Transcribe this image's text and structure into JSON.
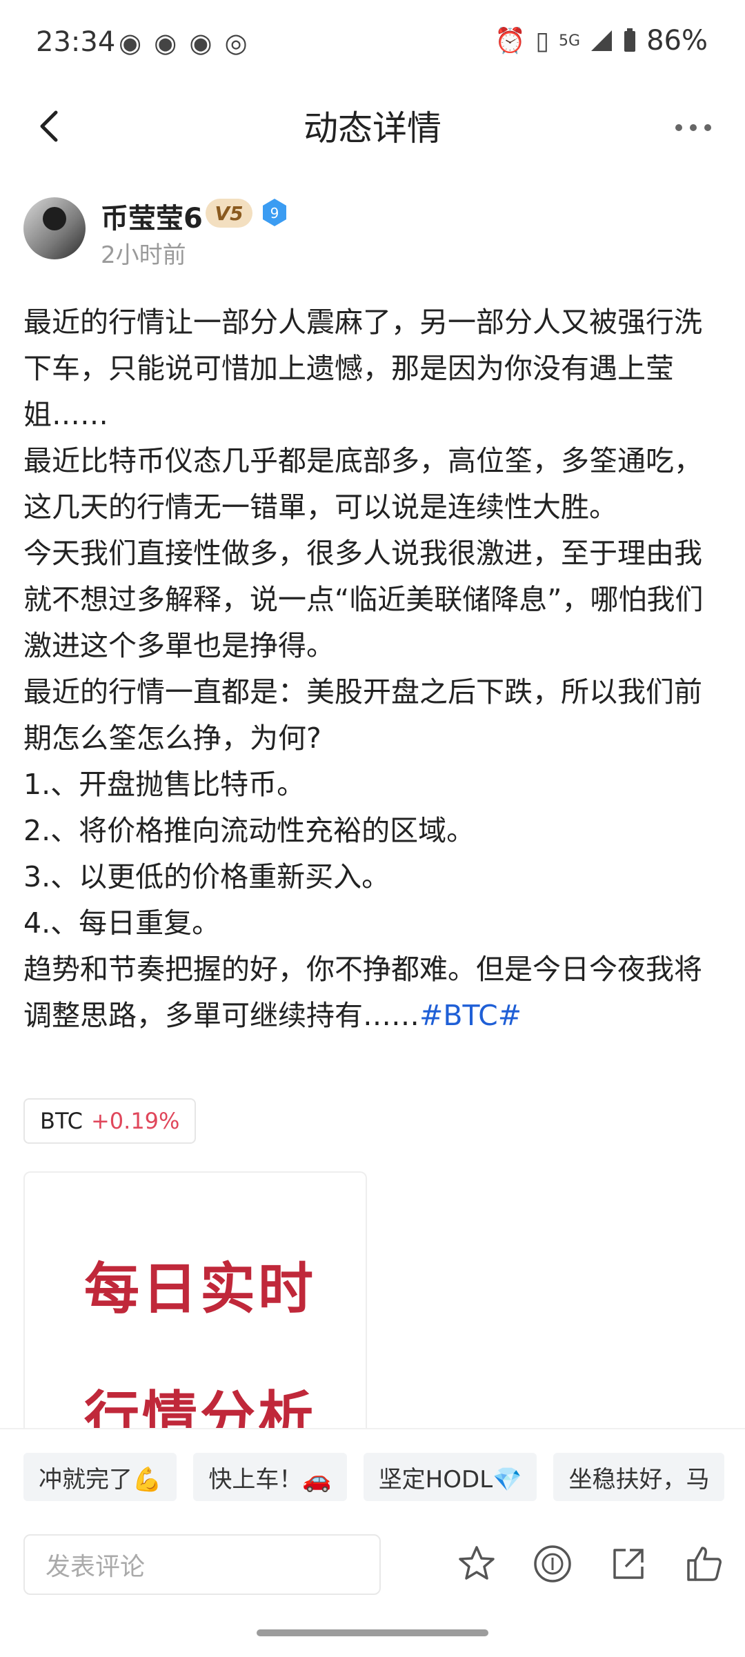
{
  "status_bar": {
    "time": "23:34",
    "app_icons": [
      "weibo-icon",
      "weibo-icon",
      "weibo-icon",
      "camera-icon"
    ],
    "right_icons": [
      "alarm-icon",
      "vibrate-icon",
      "5g-icon",
      "signal-icon",
      "battery-icon"
    ],
    "network": "5G",
    "battery": "86%"
  },
  "header": {
    "title": "动态详情"
  },
  "author": {
    "name": "币莹莹6",
    "vip": "V5",
    "level": "9",
    "time": "2小时前"
  },
  "post": {
    "paragraphs": [
      "最近的行情让一部分人震麻了，另一部分人又被强行洗下车，只能说可惜加上遗憾，那是因为你没有遇上莹姐……",
      "最近比特币仪态几乎都是底部多，高位筌，多筌通吃，这几天的行情无一错單，可以说是连续性大胜。",
      "今天我们直接性做多，很多人说我很激进，至于理由我就不想过多解释，说一点“临近美联储降息”，哪怕我们激进这个多單也是挣得。",
      "最近的行情一直都是：美股开盘之后下跌，所以我们前期怎么筌怎么挣，为何?",
      "1.、开盘抛售比特币。",
      "2.、将价格推向流动性充裕的区域。",
      "3.、以更低的价格重新买入。",
      "4.、每日重复。"
    ],
    "last_paragraph": "趋势和节奏把握的好，你不挣都难。但是今日今夜我将调整思路，多單可继续持有……",
    "hashtag": "#BTC#",
    "coin": {
      "name": "BTC",
      "change": "+0.19%"
    },
    "image_text": {
      "line1": "每日实时",
      "line2": "行情分析"
    }
  },
  "quick_replies": [
    "冲就完了💪",
    "快上车！🚗",
    "坚定HODL💎",
    "坐稳扶好，马"
  ],
  "comment": {
    "placeholder": "发表评论"
  },
  "actions": [
    "star-icon",
    "tip-icon",
    "share-icon",
    "like-icon"
  ],
  "colors": {
    "link": "#1f5fd6",
    "positive_change": "#e0475b",
    "image_text": "#c0283a"
  }
}
